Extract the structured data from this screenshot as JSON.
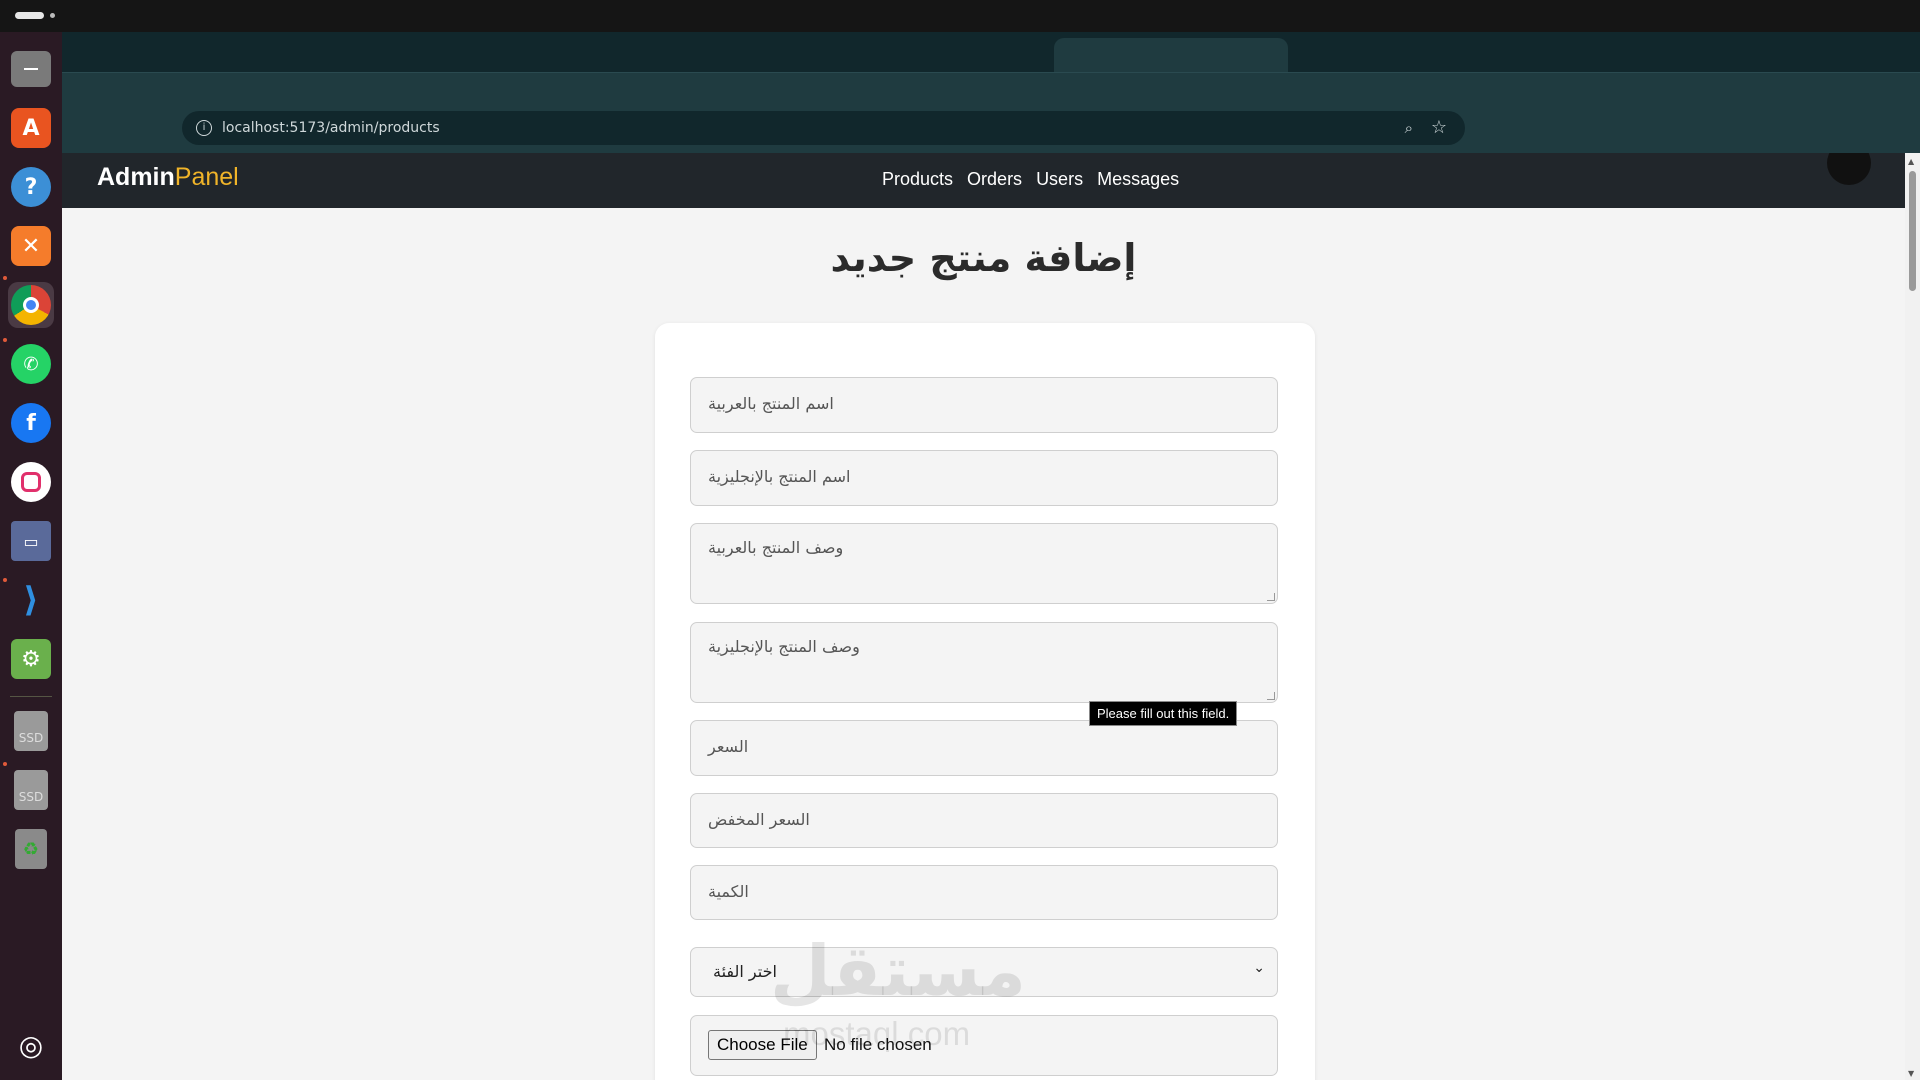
{
  "browser": {
    "url": "localhost:5173/admin/products"
  },
  "navbar": {
    "brand_main": "Admin",
    "brand_accent": "Panel",
    "links": [
      "Products",
      "Orders",
      "Users",
      "Messages"
    ]
  },
  "page": {
    "heading": "إضافة منتج جديد"
  },
  "form": {
    "name_ar_placeholder": "اسم المنتج بالعربية",
    "name_en_placeholder": "اسم المنتج بالإنجليزية",
    "desc_ar_placeholder": "وصف المنتج بالعربية",
    "desc_en_placeholder": "وصف المنتج بالإنجليزية",
    "price_placeholder": "السعر",
    "sale_price_placeholder": "السعر المخفض",
    "quantity_placeholder": "الكمية",
    "category_selected": "اختر الفئة",
    "file_button": "Choose File",
    "file_status": "No file chosen"
  },
  "tooltip": {
    "text": "Please fill out this field."
  },
  "watermark": {
    "arabic": "مستقل",
    "latin": "mostaql.com"
  },
  "colors": {
    "navbar_bg": "#21262b",
    "brand_accent": "#f0b429",
    "toolbar_bg": "#1f3b40"
  },
  "dock": {
    "icons": [
      "files-icon",
      "app-center-icon",
      "help-icon",
      "xampp-icon",
      "chrome-icon",
      "whatsapp-icon",
      "facebook-icon",
      "instagram-icon",
      "remote-desktop-icon",
      "vscode-icon",
      "android-studio-icon",
      "ssd-drive-icon",
      "ssd-drive-icon",
      "trash-icon",
      "ubuntu-icon"
    ],
    "ssd_label": "SSD"
  }
}
